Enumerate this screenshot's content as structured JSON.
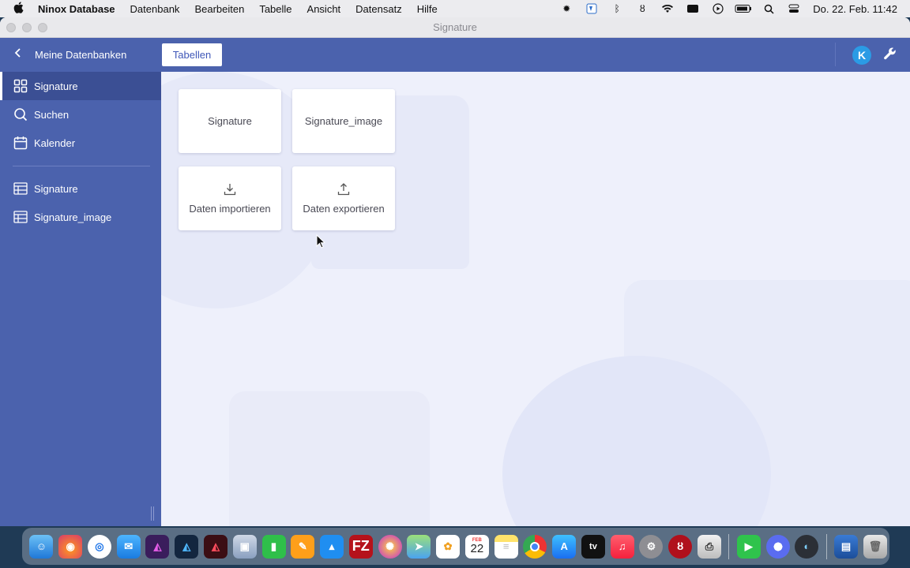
{
  "menubar": {
    "app_name": "Ninox Database",
    "menus": [
      "Datenbank",
      "Bearbeiten",
      "Tabelle",
      "Ansicht",
      "Datensatz",
      "Hilfe"
    ],
    "clock": "Do. 22. Feb.  11:42"
  },
  "window": {
    "title": "Signature"
  },
  "header": {
    "back_label": "Meine Datenbanken",
    "tab_label": "Tabellen",
    "avatar_letter": "K"
  },
  "sidebar": {
    "items": [
      {
        "label": "Signature",
        "icon": "grid-icon",
        "active": true
      },
      {
        "label": "Suchen",
        "icon": "search-icon"
      },
      {
        "label": "Kalender",
        "icon": "calendar-icon"
      },
      {
        "label": "Signature",
        "icon": "table-icon"
      },
      {
        "label": "Signature_image",
        "icon": "table-icon"
      }
    ]
  },
  "cards": [
    {
      "label": "Signature"
    },
    {
      "label": "Signature_image"
    },
    {
      "label": "Daten importieren",
      "icon": "download-icon"
    },
    {
      "label": "Daten exportieren",
      "icon": "upload-icon"
    }
  ],
  "dock": {
    "calendar_month": "FEB",
    "calendar_day": "22",
    "apps": [
      "Finder",
      "Firefox",
      "Safari",
      "Mail",
      "Affinity Photo",
      "Affinity Designer",
      "Affinity Publisher",
      "Preview",
      "Numbers",
      "Pages",
      "Keynote",
      "FileZilla",
      "Flower",
      "Maps",
      "Photos",
      "Calendar",
      "Notes",
      "Chrome",
      "App Store",
      "Apple TV",
      "Music",
      "System Settings",
      "Ninox",
      "Printer",
      "FaceTime",
      "Settings",
      "Screen",
      "Downloads",
      "Trash"
    ],
    "apple_tv_label": "tv"
  },
  "colors": {
    "accent": "#4b62ad",
    "sidebar_active": "#3b4f94",
    "avatar": "#2b9be5",
    "background": "#eef0fb"
  }
}
